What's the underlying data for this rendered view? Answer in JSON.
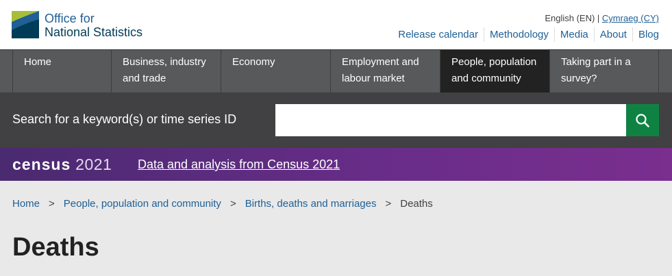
{
  "header": {
    "logo_line1": "Office for",
    "logo_line2": "National Statistics",
    "lang_current": "English (EN) |",
    "lang_alt": "Cymraeg (CY)",
    "utility_links": [
      "Release calendar",
      "Methodology",
      "Media",
      "About",
      "Blog"
    ]
  },
  "nav": {
    "items": [
      {
        "line1": "Home",
        "line2": ""
      },
      {
        "line1": "Business, industry",
        "line2": "and trade"
      },
      {
        "line1": "Economy",
        "line2": ""
      },
      {
        "line1": "Employment and",
        "line2": "labour market"
      },
      {
        "line1": "People, population",
        "line2": "and community"
      },
      {
        "line1": "Taking part in a",
        "line2": "survey?"
      }
    ],
    "active_index": 4
  },
  "search": {
    "label": "Search for a keyword(s) or time series ID",
    "value": "",
    "button_icon": "search-icon"
  },
  "census_banner": {
    "logo_word": "census",
    "logo_year": "2021",
    "link": "Data and analysis from Census 2021"
  },
  "breadcrumb": {
    "items": [
      "Home",
      "People, population and community",
      "Births, deaths and marriages"
    ],
    "separator": ">",
    "current": "Deaths"
  },
  "page": {
    "title": "Deaths"
  },
  "colors": {
    "brand_blue": "#206095",
    "nav_bg": "#58595b",
    "search_bg": "#414042",
    "search_button": "#0f8243",
    "census_purple": "#6a2d8a"
  }
}
